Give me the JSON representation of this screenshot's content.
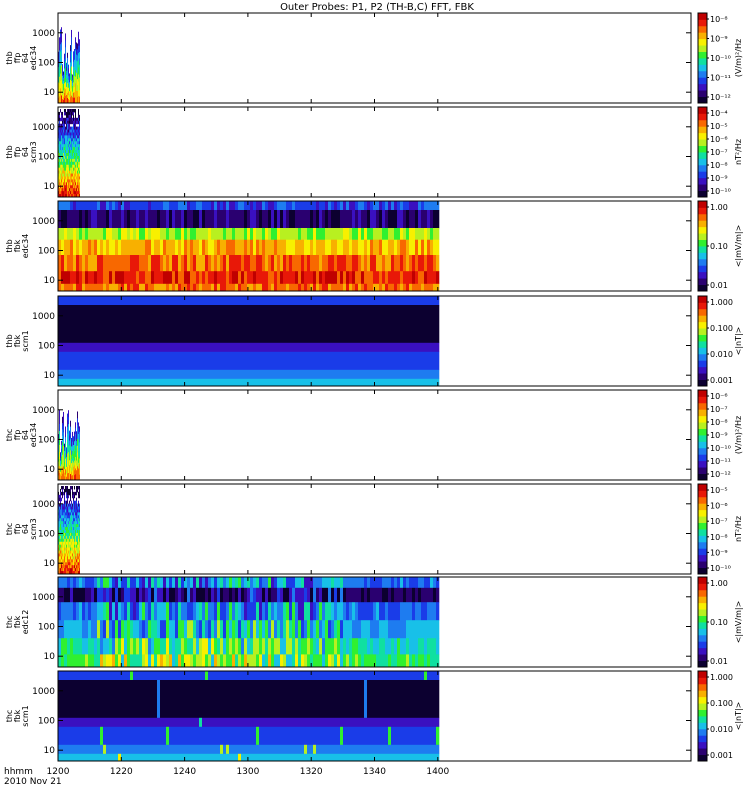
{
  "title": "Outer Probes: P1, P2 (TH-B,C) FFT, FBK",
  "footer": {
    "time_label": "hhmm",
    "date_label": "2010 Nov 21"
  },
  "colors": {
    "palette": [
      "#0c0030",
      "#2a0070",
      "#3a10c0",
      "#1a3ce8",
      "#1e7cf0",
      "#18c0e8",
      "#10e0a0",
      "#30f030",
      "#b8f020",
      "#f8f000",
      "#f8b000",
      "#f86800",
      "#e81808",
      "#c00000"
    ]
  },
  "chart_data": {
    "type": "heatmap",
    "x_axis": {
      "ticks": [
        "1200",
        "1220",
        "1240",
        "1300",
        "1320",
        "1340",
        "1400"
      ],
      "range": [
        "1200",
        "1400"
      ]
    },
    "panels": [
      {
        "id": "thb_ffp_e12",
        "ylabel": [
          "thb",
          "ffp",
          "64",
          "edc34"
        ],
        "yticks": [
          "1000",
          "100",
          "10"
        ],
        "cbar_label": "(V/m)²/Hz",
        "cbar_ticks": [
          "10⁻⁸",
          "10⁻⁹",
          "10⁻¹⁰",
          "10⁻¹¹",
          "10⁻¹²"
        ],
        "data_span": [
          "1200",
          "1207"
        ],
        "pattern": "ffp"
      },
      {
        "id": "thb_ffp_scm",
        "ylabel": [
          "thb",
          "ffp",
          "64",
          "scm3"
        ],
        "yticks": [
          "1000",
          "100",
          "10"
        ],
        "cbar_label": "nT²/Hz",
        "cbar_ticks": [
          "10⁻⁴",
          "10⁻⁵",
          "10⁻⁶",
          "10⁻⁷",
          "10⁻⁸",
          "10⁻⁹",
          "10⁻¹⁰"
        ],
        "data_span": [
          "1200",
          "1207"
        ],
        "pattern": "scm"
      },
      {
        "id": "thb_fbk_e12",
        "ylabel": [
          "thb",
          "fbk",
          "edc34"
        ],
        "yticks": [
          "1000",
          "100",
          "10"
        ],
        "cbar_label": "<|mV/m|>",
        "cbar_ticks": [
          "1.00",
          "0.10",
          "0.01"
        ],
        "data_span": [
          "1200",
          "1400"
        ],
        "pattern": "fbk_e"
      },
      {
        "id": "thb_fbk_scm",
        "ylabel": [
          "thb",
          "fbk",
          "scm1"
        ],
        "yticks": [
          "1000",
          "100",
          "10"
        ],
        "cbar_label": "<|nT|>",
        "cbar_ticks": [
          "1.000",
          "0.100",
          "0.010",
          "0.001"
        ],
        "data_span": [
          "1200",
          "1400"
        ],
        "pattern": "fbk_b"
      },
      {
        "id": "thc_ffp_e12",
        "ylabel": [
          "thc",
          "ffp",
          "64",
          "edc34"
        ],
        "yticks": [
          "1000",
          "100",
          "10"
        ],
        "cbar_label": "(V/m)²/Hz",
        "cbar_ticks": [
          "10⁻⁶",
          "10⁻⁷",
          "10⁻⁸",
          "10⁻⁹",
          "10⁻¹⁰",
          "10⁻¹¹",
          "10⁻¹²"
        ],
        "data_span": [
          "1200",
          "1207"
        ],
        "pattern": "ffp"
      },
      {
        "id": "thc_ffp_scm",
        "ylabel": [
          "thc",
          "ffp",
          "64",
          "scm3"
        ],
        "yticks": [
          "1000",
          "100",
          "10"
        ],
        "cbar_label": "nT²/Hz",
        "cbar_ticks": [
          "10⁻⁵",
          "10⁻⁶",
          "10⁻⁷",
          "10⁻⁸",
          "10⁻⁹",
          "10⁻¹⁰"
        ],
        "data_span": [
          "1200",
          "1207"
        ],
        "pattern": "scm"
      },
      {
        "id": "thc_fbk_e12",
        "ylabel": [
          "thc",
          "fbk",
          "edc12"
        ],
        "yticks": [
          "1000",
          "100",
          "10"
        ],
        "cbar_label": "<|mV/m|>",
        "cbar_ticks": [
          "1.00",
          "0.10",
          "0.01"
        ],
        "data_span": [
          "1200",
          "1400"
        ],
        "pattern": "fbk_e2"
      },
      {
        "id": "thc_fbk_scm",
        "ylabel": [
          "thc",
          "fbk",
          "scm1"
        ],
        "yticks": [
          "1000",
          "100",
          "10"
        ],
        "cbar_label": "<|nT|>",
        "cbar_ticks": [
          "1.000",
          "0.100",
          "0.010",
          "0.001"
        ],
        "data_span": [
          "1200",
          "1400"
        ],
        "pattern": "fbk_b2"
      }
    ]
  }
}
